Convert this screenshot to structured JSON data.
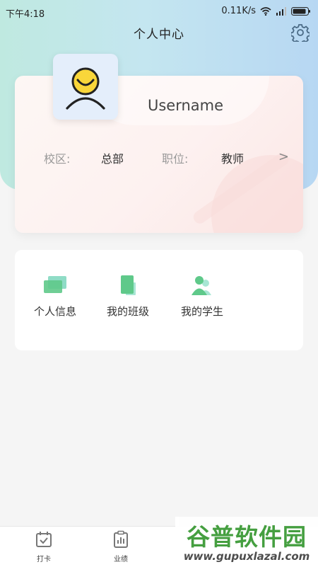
{
  "status_bar": {
    "time": "下午4:18",
    "speed": "0.11K/s"
  },
  "nav": {
    "title": "个人中心",
    "settings_icon": "gear-icon"
  },
  "profile": {
    "username": "Username",
    "campus_label": "校区:",
    "campus_value": "总部",
    "position_label": "职位:",
    "position_value": "教师",
    "avatar_icon": "smiley-face-icon",
    "chevron": ">"
  },
  "menu": {
    "items": [
      {
        "label": "个人信息",
        "icon": "id-card-icon"
      },
      {
        "label": "我的班级",
        "icon": "book-icon"
      },
      {
        "label": "我的学生",
        "icon": "users-icon"
      }
    ]
  },
  "tabs": [
    {
      "label": "打卡",
      "icon": "calendar-check-icon"
    },
    {
      "label": "业绩",
      "icon": "clipboard-chart-icon"
    }
  ],
  "watermark": {
    "title": "谷普软件园",
    "url": "www.gupuxlazal.com"
  },
  "colors": {
    "accent_green": "#5fc98a",
    "accent_teal": "#7fd8c9",
    "header_blue": "#b7d7f3",
    "watermark_green": "#3c9a36"
  }
}
